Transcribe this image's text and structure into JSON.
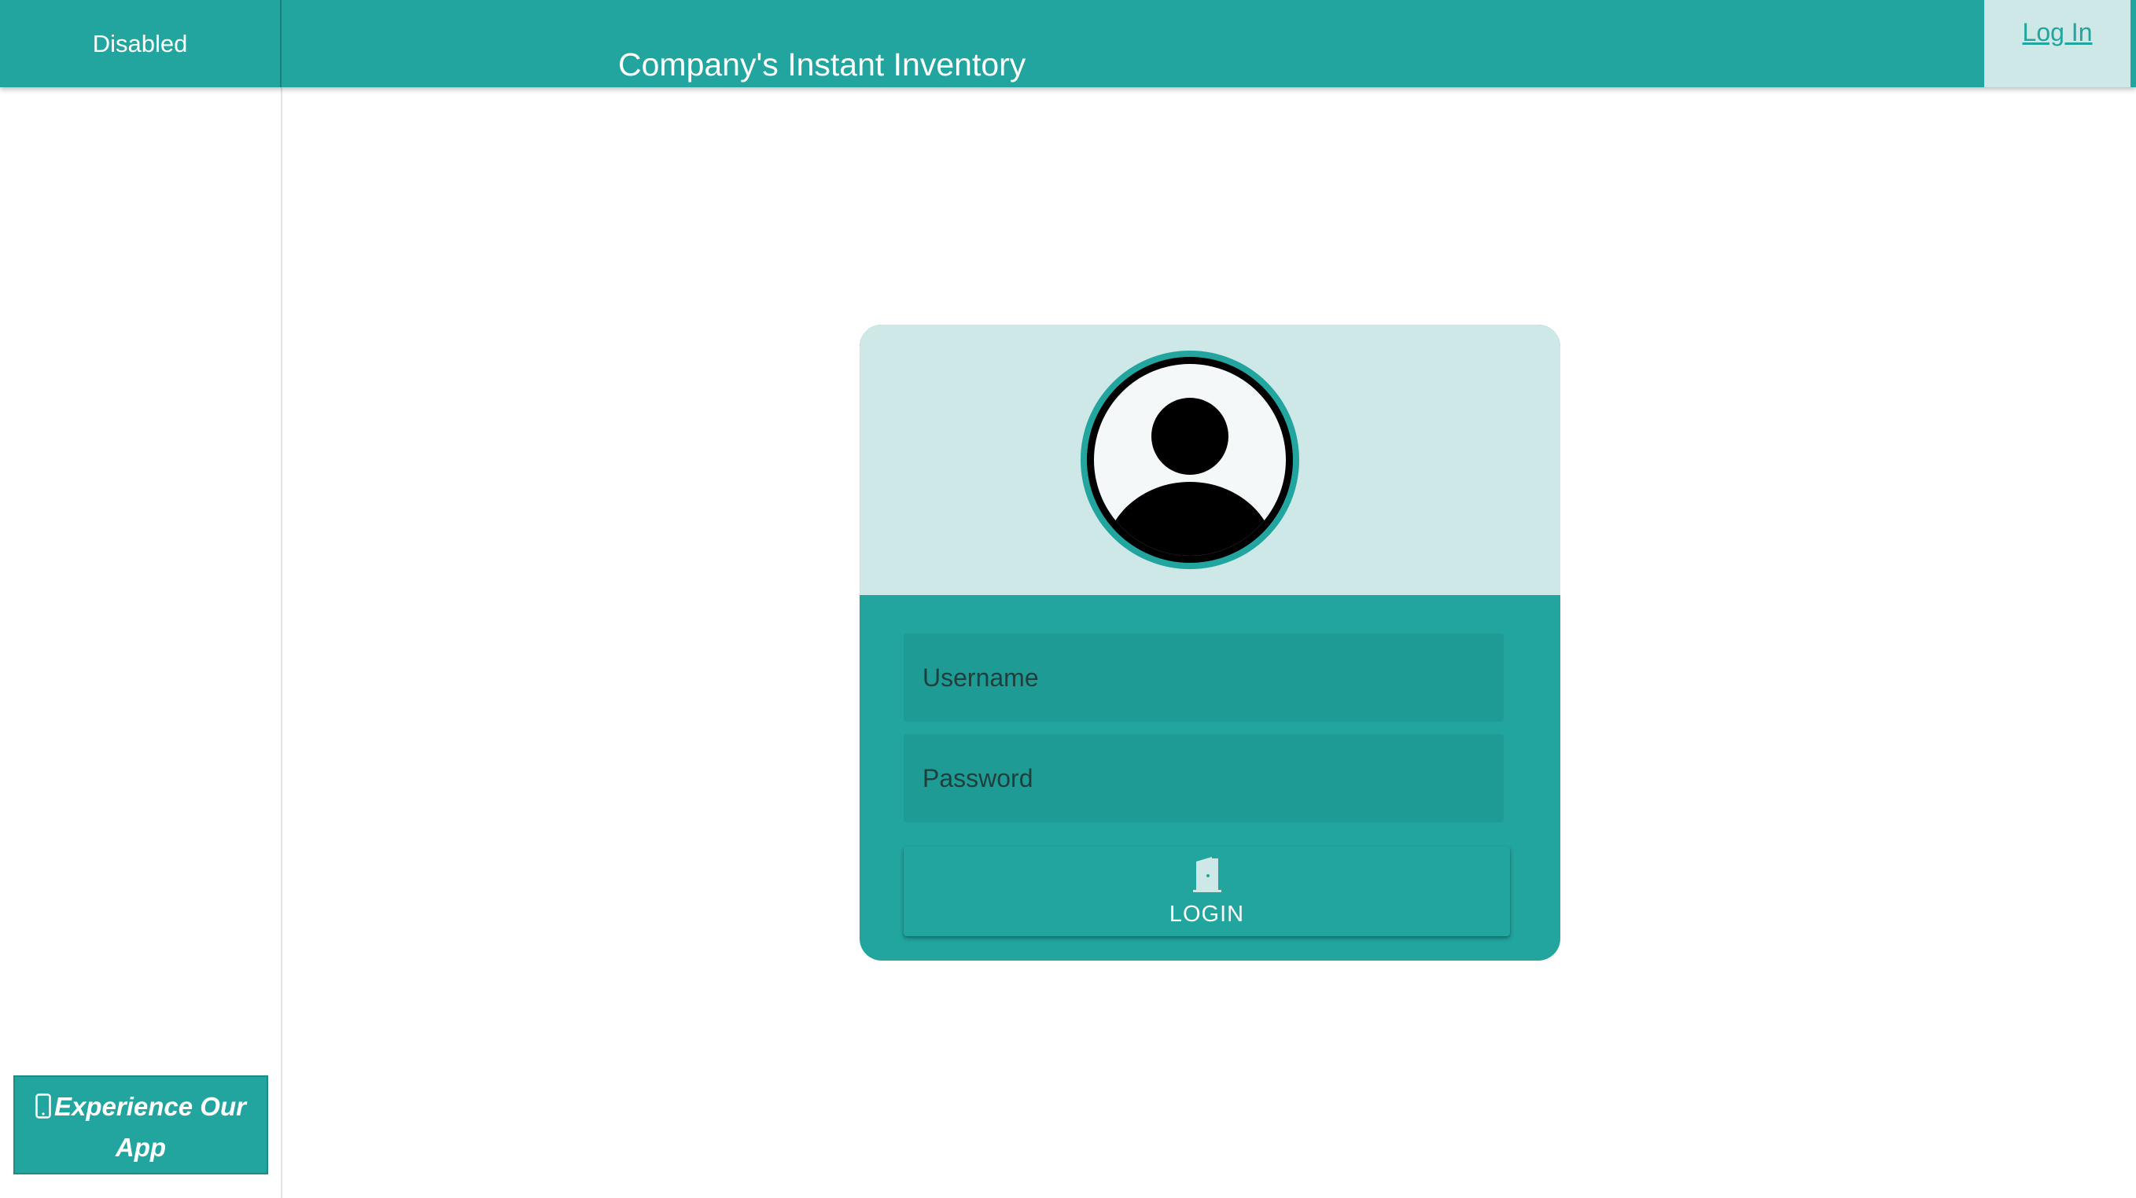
{
  "header": {
    "status_label": "Disabled",
    "app_title": "Company's Instant Inventory",
    "login_link": "Log In"
  },
  "sidebar": {
    "promo_label": "Experience Our App",
    "promo_icon": "mobile-phone-icon"
  },
  "login_card": {
    "avatar_icon": "user-avatar-icon",
    "username_placeholder": "Username",
    "password_placeholder": "Password",
    "login_button_label": "LOGIN",
    "login_button_icon": "door-open-icon"
  },
  "colors": {
    "accent": "#21a59e",
    "accent_light": "#cde8e7",
    "field_bg": "#1f9b95"
  }
}
